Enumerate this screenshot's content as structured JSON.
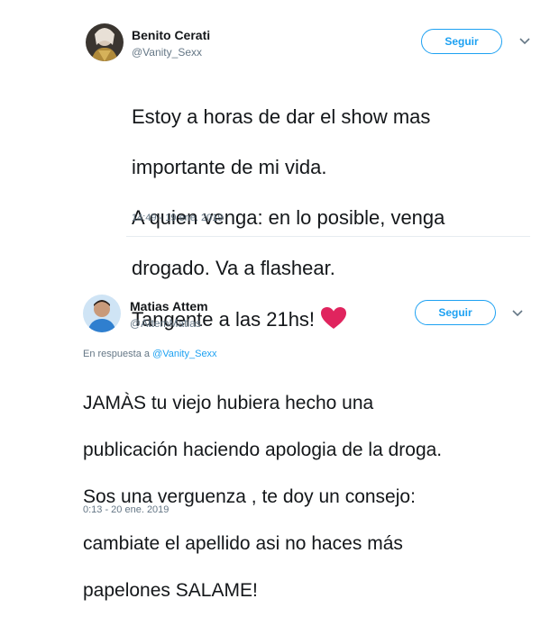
{
  "tweets": [
    {
      "name": "Benito Cerati",
      "handle": "@Vanity_Sexx",
      "follow_label": "Seguir",
      "text_lines": [
        "Estoy a horas de dar el show mas",
        "importante de mi vida.",
        "A quien venga: en lo posible, venga",
        "drogado. Va a flashear.",
        "Tangente a las 21hs!"
      ],
      "emoji": "heart-emoji",
      "timestamp": "14:49 - 19 ene. 2019"
    },
    {
      "name": "Matias Attem",
      "handle": "@AttemMatias",
      "follow_label": "Seguir",
      "reply_prefix": "En respuesta a",
      "reply_to": "@Vanity_Sexx",
      "text_lines": [
        "JAMÀS tu viejo hubiera hecho una",
        "publicación haciendo apologia de la droga.",
        "Sos una verguenza , te doy un consejo:",
        "cambiate el apellido asi no haces más",
        "papelones SALAME!"
      ],
      "timestamp": "0:13 - 20 ene. 2019"
    }
  ],
  "colors": {
    "accent": "#1da1f2",
    "heart": "#e0245e",
    "muted": "#657786"
  }
}
